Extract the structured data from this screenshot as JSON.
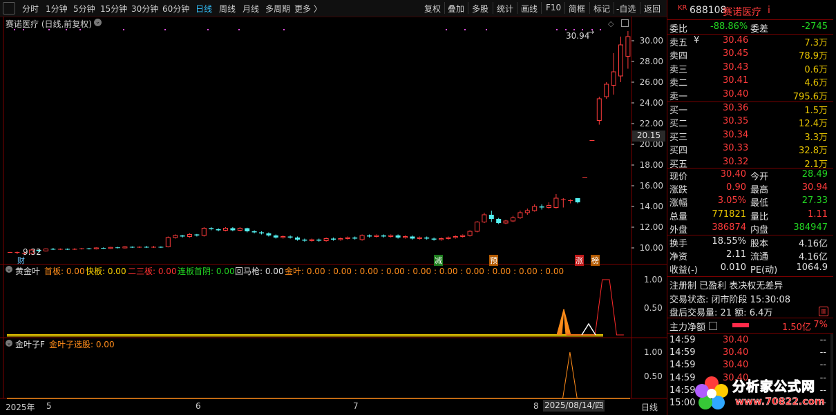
{
  "toolbar": {
    "periods": [
      "分时",
      "1分钟",
      "5分钟",
      "15分钟",
      "30分钟",
      "60分钟",
      "日线",
      "周线",
      "月线",
      "多周期",
      "更多 〉"
    ],
    "active": "日线",
    "actions": [
      "复权",
      "叠加",
      "多股",
      "统计",
      "画线",
      "F10",
      "简框",
      "标记",
      "-自选",
      "返回"
    ]
  },
  "chart_title": "赛诺医疗 (日线,前复权)",
  "chart": {
    "high_label": "30.94",
    "low_label": "9.32",
    "current_price_tag": "20.15",
    "yaxis_ticks": [
      "30.00",
      "28.00",
      "26.00",
      "24.00",
      "22.00",
      "20.00",
      "18.00",
      "16.00",
      "14.00",
      "12.00",
      "10.00"
    ],
    "markers": [
      "财",
      "减",
      "预",
      "涨",
      "榜"
    ]
  },
  "ind1": {
    "name": "黄金叶",
    "labels": [
      {
        "text": "首板: 0.00",
        "color": "#ff8c1a"
      },
      {
        "text": "快板: 0.00",
        "color": "#ffd400"
      },
      {
        "text": "二三板: 0.00",
        "color": "#ff3030"
      },
      {
        "text": "连板首阴: 0.00",
        "color": "#22d422"
      },
      {
        "text": "回马枪: 0.00",
        "color": "#e0e0e0"
      },
      {
        "text": "金叶: 0.00 : 0.00 : 0.00 : 0.00 : 0.00 : 0.00 : 0.00 : 0.00 : 0.00 : 0.00",
        "color": "#ff8c1a"
      }
    ],
    "ticks": [
      "1.00",
      "0.50"
    ]
  },
  "ind2": {
    "name": "金叶子F",
    "label": "金叶子选股: 0.00",
    "ticks": [
      "1.00",
      "0.50"
    ]
  },
  "xaxis": {
    "year": "2025年",
    "months": [
      "5",
      "6",
      "7",
      "8"
    ],
    "cursor_date": "2025/08/14/四",
    "period_label": "日线"
  },
  "stock": {
    "prefix": "KR",
    "code": "688108",
    "name": "赛诺医疗",
    "info": "i"
  },
  "orderbook": {
    "wei_bi_label": "委比",
    "wei_bi": "-88.86%",
    "wei_cha_label": "委差",
    "wei_cha": "-2745",
    "sell": [
      {
        "label": "卖五",
        "price": "30.46",
        "vol": "7.3万"
      },
      {
        "label": "卖四",
        "price": "30.45",
        "vol": "78.9万"
      },
      {
        "label": "卖三",
        "price": "30.43",
        "vol": "0.6万"
      },
      {
        "label": "卖二",
        "price": "30.41",
        "vol": "4.6万"
      },
      {
        "label": "卖一",
        "price": "30.40",
        "vol": "795.6万"
      }
    ],
    "sell5_mark": "¥",
    "buy": [
      {
        "label": "买一",
        "price": "30.36",
        "vol": "1.5万"
      },
      {
        "label": "买二",
        "price": "30.35",
        "vol": "12.4万"
      },
      {
        "label": "买三",
        "price": "30.34",
        "vol": "3.3万"
      },
      {
        "label": "买四",
        "price": "30.33",
        "vol": "32.8万"
      },
      {
        "label": "买五",
        "price": "30.32",
        "vol": "2.1万"
      }
    ]
  },
  "quote": [
    {
      "l1": "现价",
      "v1": "30.40",
      "c1": "red",
      "l2": "今开",
      "v2": "28.49",
      "c2": "green"
    },
    {
      "l1": "涨跌",
      "v1": "0.90",
      "c1": "red",
      "l2": "最高",
      "v2": "30.94",
      "c2": "red"
    },
    {
      "l1": "涨幅",
      "v1": "3.05%",
      "c1": "red",
      "l2": "最低",
      "v2": "27.33",
      "c2": "green"
    },
    {
      "l1": "总量",
      "v1": "771821",
      "c1": "yel",
      "l2": "量比",
      "v2": "1.11",
      "c2": "red"
    },
    {
      "l1": "外盘",
      "v1": "386874",
      "c1": "red",
      "l2": "内盘",
      "v2": "384947",
      "c2": "green"
    }
  ],
  "fund": [
    {
      "l1": "换手",
      "v1": "18.55%",
      "l2": "股本",
      "v2": "4.16亿"
    },
    {
      "l1": "净资",
      "v1": "2.11",
      "l2": "流通",
      "v2": "4.16亿"
    },
    {
      "l1": "收益(-)",
      "v1": "0.010",
      "l2": "PE(动)",
      "v2": "1064.9"
    }
  ],
  "status": {
    "tags": "注册制 已盈利 表决权无差异",
    "state": "交易状态: 闭市阶段 15:30:08",
    "after": "盘后交易量: 21  额: 6.4万"
  },
  "mainflow": {
    "label": "主力净额",
    "value": "1.50亿",
    "pct": "7%"
  },
  "ticks_list": [
    {
      "time": "14:59",
      "price": "30.40",
      "mark": "--"
    },
    {
      "time": "14:59",
      "price": "30.40",
      "mark": "--"
    },
    {
      "time": "14:59",
      "price": "30.40",
      "mark": "--"
    },
    {
      "time": "14:59",
      "price": "30.40",
      "mark": "--"
    },
    {
      "time": "14:59",
      "price": "",
      "mark": "--"
    },
    {
      "time": "15:00",
      "price": "",
      "mark": "--"
    }
  ],
  "watermark": {
    "cn": "分析家公式网",
    "url": "www.70822.com"
  },
  "colors": {
    "up": "#ff3b3b",
    "down": "#54f0f0",
    "axis": "#7a0000",
    "highlight": "#33c3ff"
  },
  "chart_data": {
    "type": "candlestick",
    "ylim": [
      9,
      31.5
    ],
    "candles": [
      [
        9.6,
        9.6,
        9.55,
        9.62
      ],
      [
        9.55,
        9.6,
        9.4,
        9.65
      ],
      [
        9.45,
        9.5,
        9.32,
        9.6
      ],
      [
        9.5,
        9.8,
        9.45,
        9.9
      ],
      [
        9.8,
        9.7,
        9.6,
        9.85
      ],
      [
        9.7,
        9.9,
        9.65,
        9.95
      ],
      [
        9.9,
        9.85,
        9.8,
        10.0
      ],
      [
        9.85,
        9.9,
        9.8,
        9.95
      ],
      [
        9.9,
        9.85,
        9.8,
        9.95
      ],
      [
        9.85,
        9.9,
        9.8,
        9.98
      ],
      [
        9.9,
        9.95,
        9.85,
        10.0
      ],
      [
        9.95,
        9.9,
        9.85,
        10.0
      ],
      [
        9.9,
        10.0,
        9.85,
        10.05
      ],
      [
        10.0,
        9.95,
        9.9,
        10.05
      ],
      [
        9.95,
        10.05,
        9.9,
        10.1
      ],
      [
        10.05,
        10.0,
        9.95,
        10.1
      ],
      [
        10.0,
        10.1,
        9.95,
        10.15
      ],
      [
        10.1,
        10.05,
        10.0,
        10.15
      ],
      [
        10.05,
        10.1,
        10.0,
        10.15
      ],
      [
        10.1,
        10.05,
        10.0,
        10.2
      ],
      [
        10.05,
        10.1,
        10.0,
        10.2
      ],
      [
        10.1,
        10.05,
        10.0,
        10.15
      ],
      [
        10.1,
        11.0,
        10.05,
        11.1
      ],
      [
        11.0,
        11.2,
        10.9,
        11.3
      ],
      [
        11.2,
        11.1,
        11.0,
        11.25
      ],
      [
        11.1,
        11.3,
        11.0,
        11.4
      ],
      [
        11.3,
        11.2,
        11.1,
        11.35
      ],
      [
        11.2,
        11.9,
        11.1,
        12.0
      ],
      [
        11.9,
        11.8,
        11.7,
        12.0
      ],
      [
        11.8,
        11.7,
        11.6,
        11.9
      ],
      [
        11.7,
        11.9,
        11.6,
        12.0
      ],
      [
        11.9,
        11.7,
        11.6,
        12.0
      ],
      [
        11.7,
        11.9,
        11.6,
        12.0
      ],
      [
        11.9,
        11.6,
        11.5,
        11.95
      ],
      [
        11.6,
        11.5,
        11.4,
        11.7
      ],
      [
        11.5,
        11.4,
        11.3,
        11.6
      ],
      [
        11.4,
        11.2,
        11.1,
        11.5
      ],
      [
        11.2,
        11.0,
        10.9,
        11.3
      ],
      [
        11.0,
        11.1,
        10.9,
        11.2
      ],
      [
        11.1,
        11.0,
        10.9,
        11.2
      ],
      [
        11.0,
        10.8,
        10.7,
        11.1
      ],
      [
        10.8,
        10.7,
        10.6,
        10.9
      ],
      [
        10.7,
        10.8,
        10.6,
        10.9
      ],
      [
        10.8,
        10.7,
        10.6,
        10.9
      ],
      [
        10.7,
        10.9,
        10.6,
        11.0
      ],
      [
        10.9,
        10.8,
        10.7,
        11.0
      ],
      [
        10.8,
        10.9,
        10.7,
        11.0
      ],
      [
        10.9,
        11.0,
        10.8,
        11.1
      ],
      [
        11.0,
        10.9,
        10.8,
        11.1
      ],
      [
        10.8,
        11.2,
        10.7,
        11.3
      ],
      [
        11.2,
        11.1,
        11.0,
        11.3
      ],
      [
        11.1,
        11.2,
        11.0,
        11.3
      ],
      [
        11.2,
        11.1,
        11.0,
        11.3
      ],
      [
        11.1,
        11.2,
        11.0,
        11.3
      ],
      [
        11.2,
        11.0,
        10.9,
        11.3
      ],
      [
        11.0,
        11.1,
        10.9,
        11.2
      ],
      [
        11.1,
        10.9,
        10.8,
        11.2
      ],
      [
        10.9,
        11.0,
        10.8,
        11.1
      ],
      [
        11.0,
        10.9,
        10.8,
        11.1
      ],
      [
        10.9,
        10.8,
        10.7,
        11.0
      ],
      [
        10.8,
        10.9,
        10.7,
        11.0
      ],
      [
        10.9,
        11.0,
        10.8,
        11.1
      ],
      [
        11.0,
        11.1,
        10.9,
        11.2
      ],
      [
        11.1,
        11.2,
        11.0,
        11.3
      ],
      [
        11.2,
        11.6,
        11.1,
        11.7
      ],
      [
        11.6,
        12.5,
        11.5,
        12.6
      ],
      [
        12.5,
        13.2,
        12.4,
        13.4
      ],
      [
        13.2,
        12.8,
        12.5,
        13.6
      ],
      [
        12.8,
        12.4,
        12.3,
        12.9
      ],
      [
        12.4,
        12.6,
        12.3,
        12.7
      ],
      [
        12.6,
        12.9,
        12.5,
        13.1
      ],
      [
        12.9,
        13.4,
        12.8,
        13.6
      ],
      [
        13.4,
        13.6,
        13.2,
        13.8
      ],
      [
        13.6,
        14.0,
        13.5,
        14.2
      ],
      [
        14.0,
        13.9,
        13.7,
        14.2
      ],
      [
        13.9,
        14.1,
        13.8,
        14.4
      ],
      [
        13.9,
        14.8,
        13.8,
        15.2
      ],
      [
        14.7,
        14.7,
        13.9,
        14.8
      ],
      [
        14.6,
        14.6,
        14.3,
        14.7
      ],
      [
        14.8,
        14.4,
        14.3,
        14.8
      ],
      [
        16.8,
        16.8,
        16.8,
        16.8
      ],
      [
        20.4,
        20.4,
        20.4,
        20.4
      ],
      [
        22.3,
        24.4,
        21.9,
        24.6
      ],
      [
        24.6,
        25.8,
        24.4,
        26.0
      ],
      [
        25.7,
        27.0,
        24.8,
        28.8
      ],
      [
        26.6,
        29.6,
        26.0,
        30.4
      ],
      [
        28.5,
        30.4,
        27.3,
        30.94
      ]
    ],
    "marks": {
      "high": 30.94,
      "low": 9.32
    },
    "ind1_series": [
      0,
      0,
      0,
      0,
      0,
      0,
      0,
      0,
      0,
      0,
      0,
      0,
      0,
      0,
      0,
      0,
      0,
      0,
      0,
      0,
      0,
      0,
      0,
      0,
      0,
      0,
      0,
      0,
      0,
      0,
      0,
      0,
      0,
      0,
      0,
      0,
      0,
      0,
      0,
      0,
      0,
      0,
      0,
      0,
      0,
      0,
      0,
      0,
      0,
      0,
      0,
      0,
      0,
      0,
      0,
      0,
      0,
      0,
      0,
      0,
      0,
      0,
      0,
      0,
      0,
      0,
      0,
      0,
      0,
      0,
      0,
      0,
      0,
      0,
      0,
      0,
      0,
      0,
      0,
      0,
      0,
      0,
      0,
      1,
      1,
      0,
      0
    ],
    "ind2_series": [
      0,
      0,
      0,
      0,
      0,
      0,
      0,
      0,
      0,
      0,
      0,
      0,
      0,
      0,
      0,
      0,
      0,
      0,
      0,
      0,
      0,
      0,
      0,
      0,
      0,
      0,
      0,
      0,
      0,
      0,
      0,
      0,
      0,
      0,
      0,
      0,
      0,
      0,
      0,
      0,
      0,
      0,
      0,
      0,
      0,
      0,
      0,
      0,
      0,
      0,
      0,
      0,
      0,
      0,
      0,
      0,
      0,
      0,
      0,
      0,
      0,
      0,
      0,
      0,
      0,
      0,
      0,
      0,
      0,
      0,
      0,
      0,
      0,
      0,
      0,
      0,
      0,
      0,
      0,
      0,
      0,
      1,
      0,
      0,
      0,
      0,
      0
    ]
  }
}
